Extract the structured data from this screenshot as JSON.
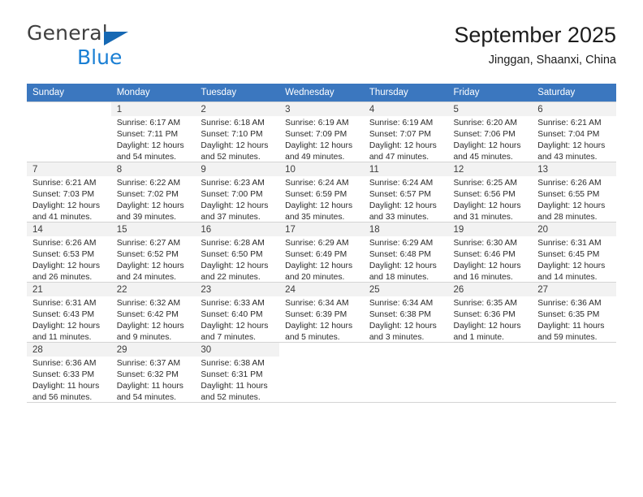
{
  "brand": {
    "name_part1": "General",
    "name_part2": "Blue",
    "triangle_icon": "blue-triangle-icon"
  },
  "header": {
    "title": "September 2025",
    "subtitle": "Jinggan, Shaanxi, China"
  },
  "colors": {
    "header_blue": "#3b77bf",
    "brand_blue": "#1a7fd4",
    "daynum_bg": "#f2f2f2",
    "grid_line": "#d4d4d4"
  },
  "weekdays": [
    "Sunday",
    "Monday",
    "Tuesday",
    "Wednesday",
    "Thursday",
    "Friday",
    "Saturday"
  ],
  "labels": {
    "sunrise": "Sunrise:",
    "sunset": "Sunset:",
    "daylight": "Daylight:"
  },
  "weeks": [
    [
      {
        "day": "",
        "sunrise": "",
        "sunset": "",
        "daylight1": "",
        "daylight2": ""
      },
      {
        "day": "1",
        "sunrise": "Sunrise: 6:17 AM",
        "sunset": "Sunset: 7:11 PM",
        "daylight1": "Daylight: 12 hours",
        "daylight2": "and 54 minutes."
      },
      {
        "day": "2",
        "sunrise": "Sunrise: 6:18 AM",
        "sunset": "Sunset: 7:10 PM",
        "daylight1": "Daylight: 12 hours",
        "daylight2": "and 52 minutes."
      },
      {
        "day": "3",
        "sunrise": "Sunrise: 6:19 AM",
        "sunset": "Sunset: 7:09 PM",
        "daylight1": "Daylight: 12 hours",
        "daylight2": "and 49 minutes."
      },
      {
        "day": "4",
        "sunrise": "Sunrise: 6:19 AM",
        "sunset": "Sunset: 7:07 PM",
        "daylight1": "Daylight: 12 hours",
        "daylight2": "and 47 minutes."
      },
      {
        "day": "5",
        "sunrise": "Sunrise: 6:20 AM",
        "sunset": "Sunset: 7:06 PM",
        "daylight1": "Daylight: 12 hours",
        "daylight2": "and 45 minutes."
      },
      {
        "day": "6",
        "sunrise": "Sunrise: 6:21 AM",
        "sunset": "Sunset: 7:04 PM",
        "daylight1": "Daylight: 12 hours",
        "daylight2": "and 43 minutes."
      }
    ],
    [
      {
        "day": "7",
        "sunrise": "Sunrise: 6:21 AM",
        "sunset": "Sunset: 7:03 PM",
        "daylight1": "Daylight: 12 hours",
        "daylight2": "and 41 minutes."
      },
      {
        "day": "8",
        "sunrise": "Sunrise: 6:22 AM",
        "sunset": "Sunset: 7:02 PM",
        "daylight1": "Daylight: 12 hours",
        "daylight2": "and 39 minutes."
      },
      {
        "day": "9",
        "sunrise": "Sunrise: 6:23 AM",
        "sunset": "Sunset: 7:00 PM",
        "daylight1": "Daylight: 12 hours",
        "daylight2": "and 37 minutes."
      },
      {
        "day": "10",
        "sunrise": "Sunrise: 6:24 AM",
        "sunset": "Sunset: 6:59 PM",
        "daylight1": "Daylight: 12 hours",
        "daylight2": "and 35 minutes."
      },
      {
        "day": "11",
        "sunrise": "Sunrise: 6:24 AM",
        "sunset": "Sunset: 6:57 PM",
        "daylight1": "Daylight: 12 hours",
        "daylight2": "and 33 minutes."
      },
      {
        "day": "12",
        "sunrise": "Sunrise: 6:25 AM",
        "sunset": "Sunset: 6:56 PM",
        "daylight1": "Daylight: 12 hours",
        "daylight2": "and 31 minutes."
      },
      {
        "day": "13",
        "sunrise": "Sunrise: 6:26 AM",
        "sunset": "Sunset: 6:55 PM",
        "daylight1": "Daylight: 12 hours",
        "daylight2": "and 28 minutes."
      }
    ],
    [
      {
        "day": "14",
        "sunrise": "Sunrise: 6:26 AM",
        "sunset": "Sunset: 6:53 PM",
        "daylight1": "Daylight: 12 hours",
        "daylight2": "and 26 minutes."
      },
      {
        "day": "15",
        "sunrise": "Sunrise: 6:27 AM",
        "sunset": "Sunset: 6:52 PM",
        "daylight1": "Daylight: 12 hours",
        "daylight2": "and 24 minutes."
      },
      {
        "day": "16",
        "sunrise": "Sunrise: 6:28 AM",
        "sunset": "Sunset: 6:50 PM",
        "daylight1": "Daylight: 12 hours",
        "daylight2": "and 22 minutes."
      },
      {
        "day": "17",
        "sunrise": "Sunrise: 6:29 AM",
        "sunset": "Sunset: 6:49 PM",
        "daylight1": "Daylight: 12 hours",
        "daylight2": "and 20 minutes."
      },
      {
        "day": "18",
        "sunrise": "Sunrise: 6:29 AM",
        "sunset": "Sunset: 6:48 PM",
        "daylight1": "Daylight: 12 hours",
        "daylight2": "and 18 minutes."
      },
      {
        "day": "19",
        "sunrise": "Sunrise: 6:30 AM",
        "sunset": "Sunset: 6:46 PM",
        "daylight1": "Daylight: 12 hours",
        "daylight2": "and 16 minutes."
      },
      {
        "day": "20",
        "sunrise": "Sunrise: 6:31 AM",
        "sunset": "Sunset: 6:45 PM",
        "daylight1": "Daylight: 12 hours",
        "daylight2": "and 14 minutes."
      }
    ],
    [
      {
        "day": "21",
        "sunrise": "Sunrise: 6:31 AM",
        "sunset": "Sunset: 6:43 PM",
        "daylight1": "Daylight: 12 hours",
        "daylight2": "and 11 minutes."
      },
      {
        "day": "22",
        "sunrise": "Sunrise: 6:32 AM",
        "sunset": "Sunset: 6:42 PM",
        "daylight1": "Daylight: 12 hours",
        "daylight2": "and 9 minutes."
      },
      {
        "day": "23",
        "sunrise": "Sunrise: 6:33 AM",
        "sunset": "Sunset: 6:40 PM",
        "daylight1": "Daylight: 12 hours",
        "daylight2": "and 7 minutes."
      },
      {
        "day": "24",
        "sunrise": "Sunrise: 6:34 AM",
        "sunset": "Sunset: 6:39 PM",
        "daylight1": "Daylight: 12 hours",
        "daylight2": "and 5 minutes."
      },
      {
        "day": "25",
        "sunrise": "Sunrise: 6:34 AM",
        "sunset": "Sunset: 6:38 PM",
        "daylight1": "Daylight: 12 hours",
        "daylight2": "and 3 minutes."
      },
      {
        "day": "26",
        "sunrise": "Sunrise: 6:35 AM",
        "sunset": "Sunset: 6:36 PM",
        "daylight1": "Daylight: 12 hours",
        "daylight2": "and 1 minute."
      },
      {
        "day": "27",
        "sunrise": "Sunrise: 6:36 AM",
        "sunset": "Sunset: 6:35 PM",
        "daylight1": "Daylight: 11 hours",
        "daylight2": "and 59 minutes."
      }
    ],
    [
      {
        "day": "28",
        "sunrise": "Sunrise: 6:36 AM",
        "sunset": "Sunset: 6:33 PM",
        "daylight1": "Daylight: 11 hours",
        "daylight2": "and 56 minutes."
      },
      {
        "day": "29",
        "sunrise": "Sunrise: 6:37 AM",
        "sunset": "Sunset: 6:32 PM",
        "daylight1": "Daylight: 11 hours",
        "daylight2": "and 54 minutes."
      },
      {
        "day": "30",
        "sunrise": "Sunrise: 6:38 AM",
        "sunset": "Sunset: 6:31 PM",
        "daylight1": "Daylight: 11 hours",
        "daylight2": "and 52 minutes."
      },
      {
        "day": "",
        "sunrise": "",
        "sunset": "",
        "daylight1": "",
        "daylight2": ""
      },
      {
        "day": "",
        "sunrise": "",
        "sunset": "",
        "daylight1": "",
        "daylight2": ""
      },
      {
        "day": "",
        "sunrise": "",
        "sunset": "",
        "daylight1": "",
        "daylight2": ""
      },
      {
        "day": "",
        "sunrise": "",
        "sunset": "",
        "daylight1": "",
        "daylight2": ""
      }
    ]
  ]
}
